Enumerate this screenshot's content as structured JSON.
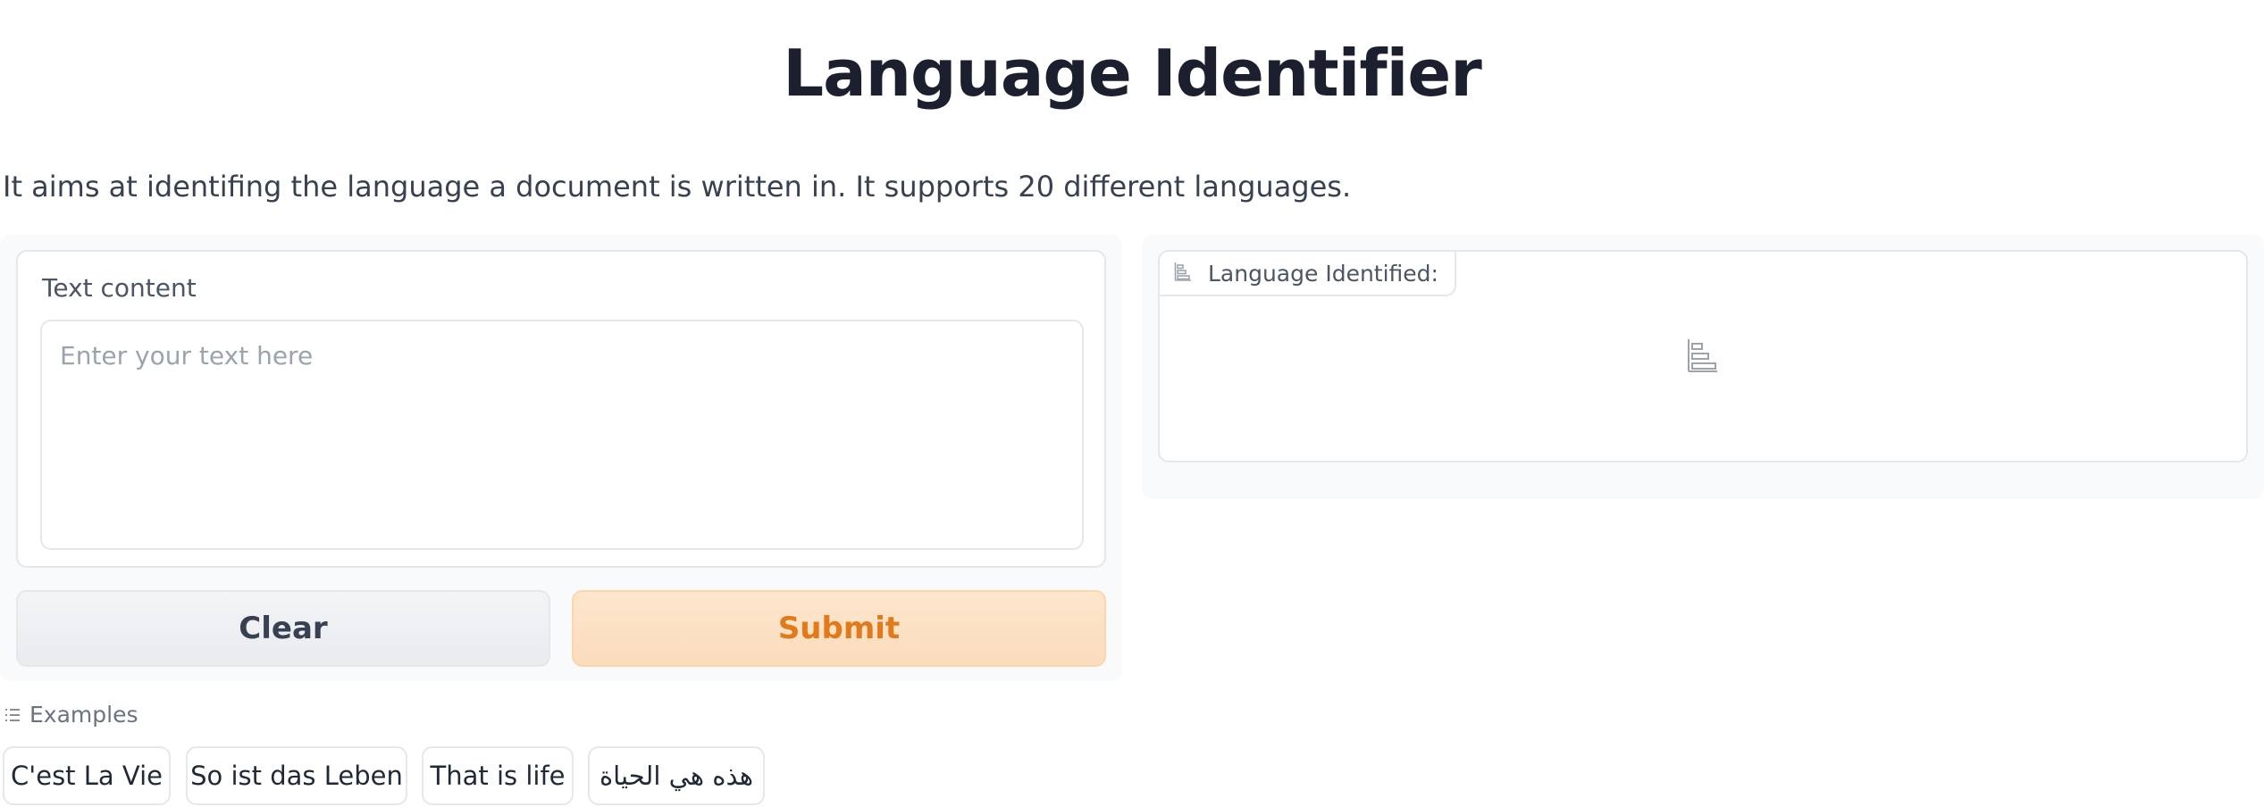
{
  "page": {
    "title": "Language Identifier",
    "description": "It aims at identifing the language a document is written in. It supports 20 different languages."
  },
  "input": {
    "label": "Text content",
    "placeholder": "Enter your text here",
    "value": ""
  },
  "buttons": {
    "clear_label": "Clear",
    "submit_label": "Submit"
  },
  "output": {
    "label": "Language Identified:",
    "icon": "bar-chart-icon"
  },
  "examples": {
    "header": "Examples",
    "icon": "list-icon",
    "items": [
      "C'est La Vie",
      "So ist das Leben",
      "That is life",
      "هذه هي الحياة"
    ]
  },
  "colors": {
    "accent": "#e07a1b",
    "submit_bg": "#fde6cc",
    "clear_bg": "#f3f4f6",
    "panel_bg": "#f9fafb",
    "border": "#e5e7eb"
  }
}
